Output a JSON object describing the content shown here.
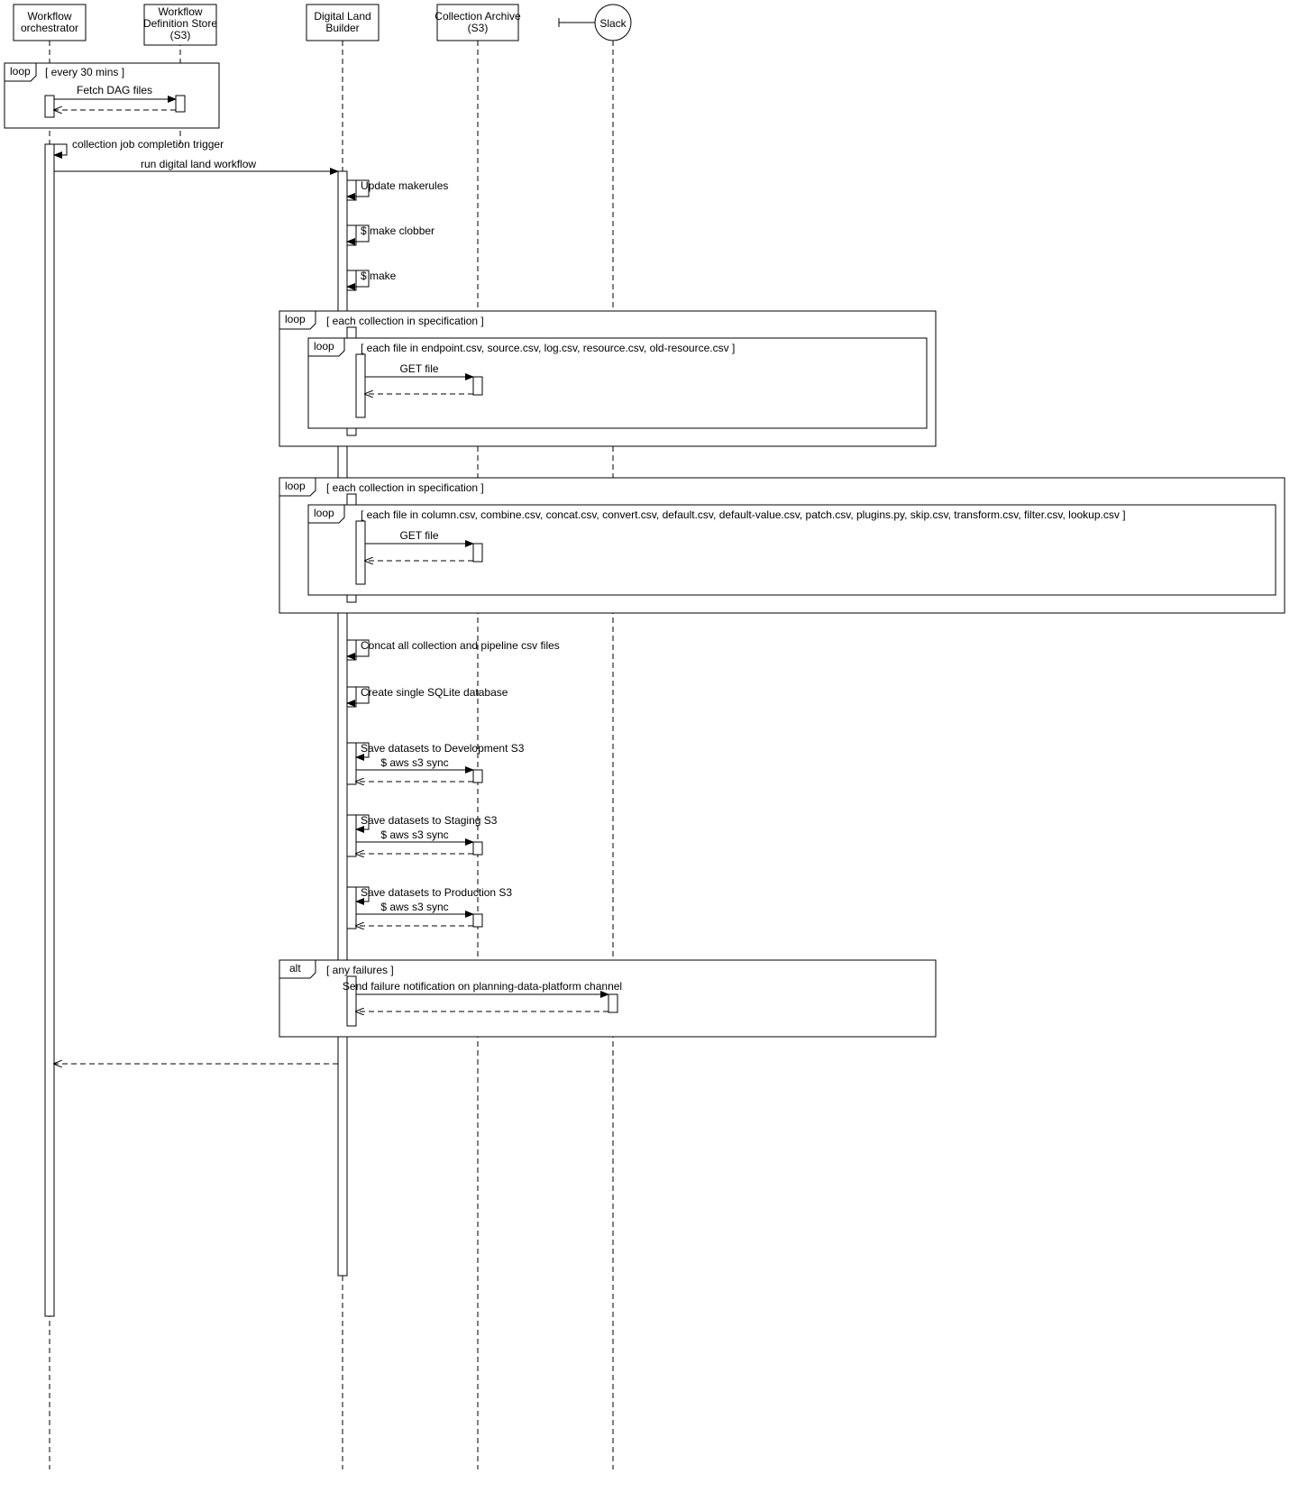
{
  "participants": {
    "orchestrator": "Workflow orchestrator",
    "defstore1": "Workflow",
    "defstore2": "Definition Store",
    "defstore3": "(S3)",
    "builder1": "Digital Land",
    "builder2": "Builder",
    "archive1": "Collection Archive",
    "archive2": "(S3)",
    "slack": "Slack"
  },
  "frames": {
    "loop_30": "loop",
    "loop_30_guard": "[ every 30 mins ]",
    "loop_outer1": "loop",
    "loop_outer1_guard": "[ each collection in specification ]",
    "loop_inner1": "loop",
    "loop_inner1_guard": "[ each file in endpoint.csv, source.csv, log.csv, resource.csv, old-resource.csv ]",
    "loop_outer2": "loop",
    "loop_outer2_guard": "[ each collection in specification ]",
    "loop_inner2": "loop",
    "loop_inner2_guard": "[ each file in column.csv, combine.csv, concat.csv, convert.csv, default.csv, default-value.csv, patch.csv, plugins.py, skip.csv, transform.csv, filter.csv, lookup.csv ]",
    "alt": "alt",
    "alt_guard": "[ any failures ]"
  },
  "messages": {
    "fetch_dag": "Fetch DAG files",
    "trigger": "collection job completion trigger",
    "run_workflow": "run digital land workflow",
    "update_makerules": "Update makerules",
    "make_clobber": "$ make clobber",
    "make": "$ make",
    "get_file": "GET file",
    "concat": "Concat all collection and pipeline csv files",
    "create_sqlite": "Create single SQLite database",
    "save_dev": "Save datasets to Development S3",
    "save_stage": "Save datasets to Staging S3",
    "save_prod": "Save datasets to Production S3",
    "aws_sync": "$ aws s3 sync",
    "slack_msg": "Send failure notification on planning-data-platform channel"
  }
}
